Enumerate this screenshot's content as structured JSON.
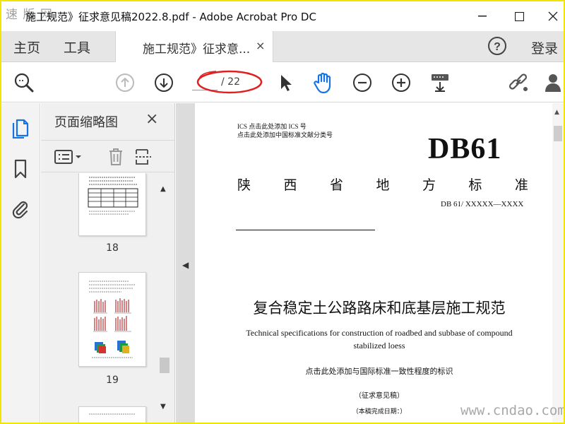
{
  "window": {
    "title": "施工规范》征求意见稿2022.8.pdf - Adobe Acrobat Pro DC",
    "watermark_top": "速 版 网"
  },
  "tabs": {
    "home": "主页",
    "tools": "工具",
    "document": "施工规范》征求意...",
    "close_glyph": "×",
    "login": "登录"
  },
  "toolbar": {
    "current_page": "",
    "total_pages": "/ 22",
    "icons": [
      "search-zoom-icon",
      "previous-page-icon",
      "next-page-icon",
      "select-cursor-icon",
      "hand-tool-icon",
      "zoom-out-icon",
      "zoom-in-icon",
      "page-display-icon",
      "share-link-icon",
      "add-user-icon"
    ],
    "annotation_color": "#e02020"
  },
  "thumbnail_panel": {
    "title": "页面缩略图",
    "close_glyph": "×",
    "pages": [
      "18",
      "19"
    ]
  },
  "document": {
    "ics_line": "ICS   点击此处添加 ICS 号",
    "class_line": "点击此处添加中国标准文献分类号",
    "code": "DB61",
    "province_chars": [
      "陕",
      "西",
      "省",
      "地",
      "方",
      "标",
      "准"
    ],
    "std_number": "DB 61/  XXXXX—XXXX",
    "title_cn": "复合稳定土公路路床和底基层施工规范",
    "title_en_line1": "Technical specifications for construction of roadbed and subbase of compound",
    "title_en_line2": "stabilized loess",
    "consistency_note": "点击此处添加与国际标准一致性程度的标识",
    "draft_label": "（征求意见稿）",
    "date_label": "（本稿完成日期：）"
  },
  "watermark_bottom": "www.cndao.com",
  "colors": {
    "accent_blue": "#1473e6",
    "frame_yellow": "#f2e600"
  }
}
